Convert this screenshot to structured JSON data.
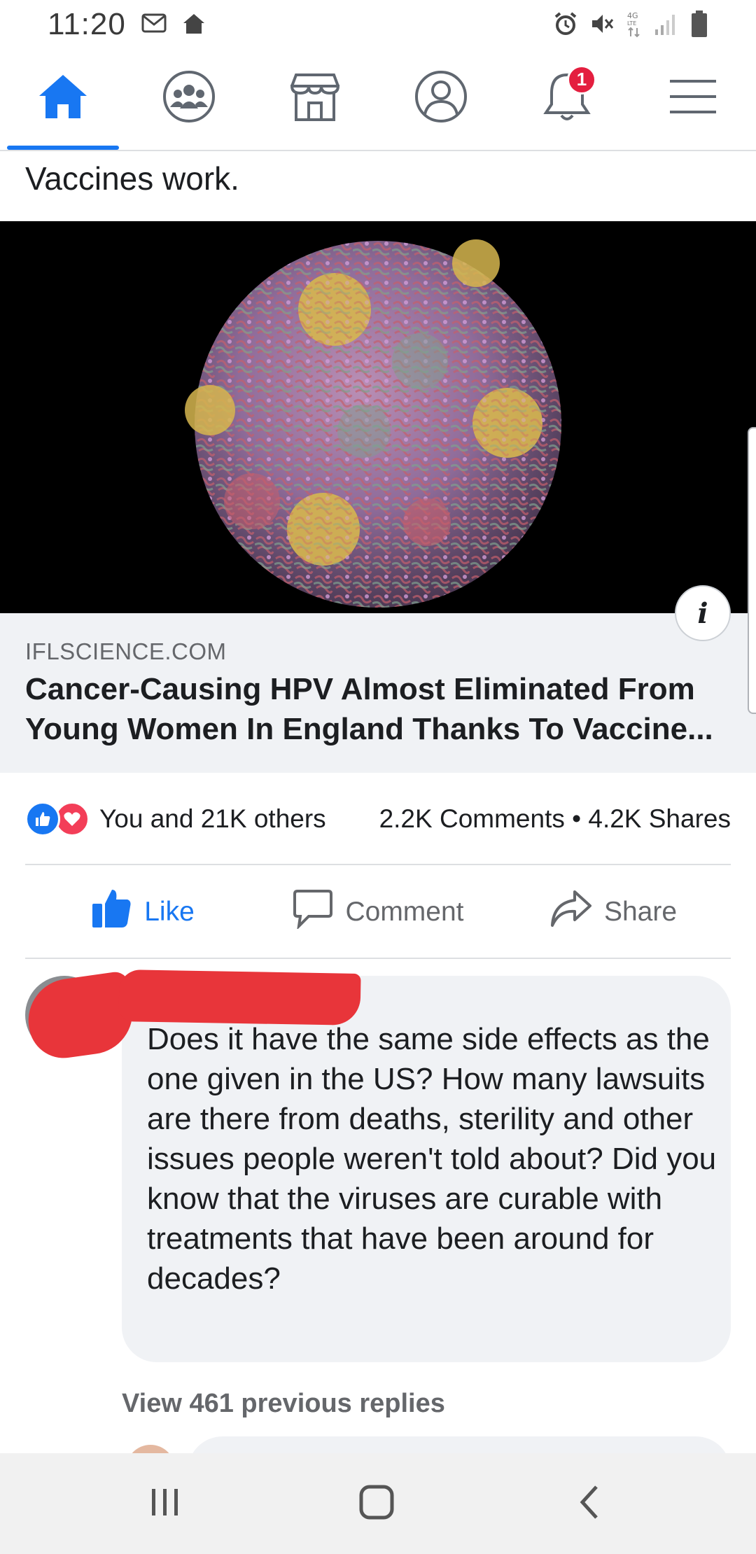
{
  "status_bar": {
    "time": "11:20",
    "icons": [
      "gmail-icon",
      "home-notification-icon",
      "alarm-icon",
      "mute-icon",
      "network-4g-icon",
      "signal-icon",
      "battery-icon"
    ]
  },
  "nav": {
    "items": [
      {
        "name": "home",
        "icon": "home-icon",
        "active": true
      },
      {
        "name": "groups",
        "icon": "groups-icon"
      },
      {
        "name": "marketplace",
        "icon": "marketplace-icon"
      },
      {
        "name": "profile",
        "icon": "profile-icon"
      },
      {
        "name": "notifications",
        "icon": "bell-icon",
        "badge": "1"
      },
      {
        "name": "menu",
        "icon": "hamburger-menu-icon"
      }
    ],
    "accent": "#1877f2",
    "badge_color": "#e41e3f"
  },
  "post": {
    "text": "Vaccines work.",
    "link": {
      "domain": "IFLSCIENCE.COM",
      "title": "Cancer-Causing HPV Almost Eliminated From Young Women In England Thanks To Vaccine..."
    },
    "reactions": {
      "summary": "You and 21K others",
      "counts": "2.2K Comments • 4.2K Shares"
    },
    "actions": {
      "like": "Like",
      "comment": "Comment",
      "share": "Share"
    }
  },
  "comment": {
    "text": "Does it have the same side effects as the one given in the US? How many lawsuits are there from deaths, sterility and other issues people weren't told about? Did you know that the viruses are curable with treatments that have been around for decades?",
    "view_replies": "View 461 previous replies"
  }
}
